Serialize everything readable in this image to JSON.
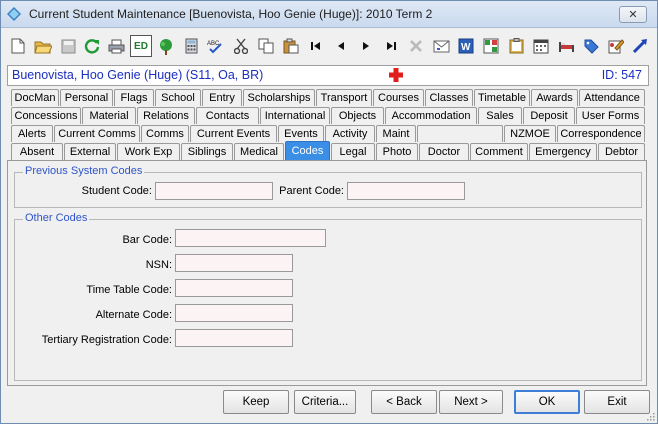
{
  "window": {
    "title": "Current Student Maintenance  [Buenovista, Hoo Genie (Huge)]:  2010 Term 2",
    "close_glyph": "✕"
  },
  "toolbar": {
    "items": [
      "new-doc-icon",
      "open-folder-icon",
      "save-icon",
      "refresh-icon",
      "print-icon",
      "ed-icon",
      "tree-icon",
      "calculator-icon",
      "spellcheck-icon",
      "cut-icon",
      "copy-icon",
      "paste-icon",
      "first-record-icon",
      "previous-record-icon",
      "next-record-icon",
      "last-record-icon",
      "delete-icon",
      "email-icon",
      "word-icon",
      "grid-icon",
      "clipboard-icon",
      "calendar-icon",
      "bed-icon",
      "tag-icon",
      "edit-sheet-icon",
      "pointer-icon"
    ],
    "ed_label": "ED"
  },
  "header": {
    "student_name": "Buenovista, Hoo Genie (Huge) (S11, Oa, BR)",
    "student_id": "ID: 547"
  },
  "tabs": {
    "row1": [
      "DocMan",
      "Personal",
      "Flags",
      "School",
      "Entry",
      "Scholarships",
      "Transport",
      "Courses",
      "Classes",
      "Timetable",
      "Awards",
      "Attendance"
    ],
    "row2": [
      "Concessions",
      "Material",
      "Relations",
      "Contacts",
      "International",
      "Objects",
      "Accommodation",
      "Sales",
      "Deposit",
      "User Forms"
    ],
    "row3": [
      "Alerts",
      "Current Comms",
      "Comms",
      "Current Events",
      "Events",
      "Activity",
      "Maint",
      "",
      "NZMOE",
      "Correspondence"
    ],
    "row4": [
      "Absent",
      "External",
      "Work Exp",
      "Siblings",
      "Medical",
      "Codes",
      "Legal",
      "Photo",
      "Doctor",
      "Comment",
      "Emergency",
      "Debtor"
    ],
    "active": "Codes"
  },
  "previous_codes": {
    "legend": "Previous System Codes",
    "student_code_label": "Student Code:",
    "student_code_value": "",
    "parent_code_label": "Parent Code:",
    "parent_code_value": ""
  },
  "other_codes": {
    "legend": "Other Codes",
    "bar_code_label": "Bar Code:",
    "bar_code_value": "",
    "nsn_label": "NSN:",
    "nsn_value": "",
    "timetable_code_label": "Time Table Code:",
    "timetable_code_value": "",
    "alternate_code_label": "Alternate Code:",
    "alternate_code_value": "",
    "tertiary_code_label": "Tertiary Registration Code:",
    "tertiary_code_value": ""
  },
  "buttons": {
    "keep": "Keep",
    "criteria": "Criteria...",
    "back": "< Back",
    "next": "Next >",
    "ok": "OK",
    "exit": "Exit"
  },
  "colors": {
    "accent": "#3a8ee6",
    "header_text": "#1c2fbf",
    "legend_text": "#2f54c8",
    "field_bg": "#fcf4f4"
  }
}
